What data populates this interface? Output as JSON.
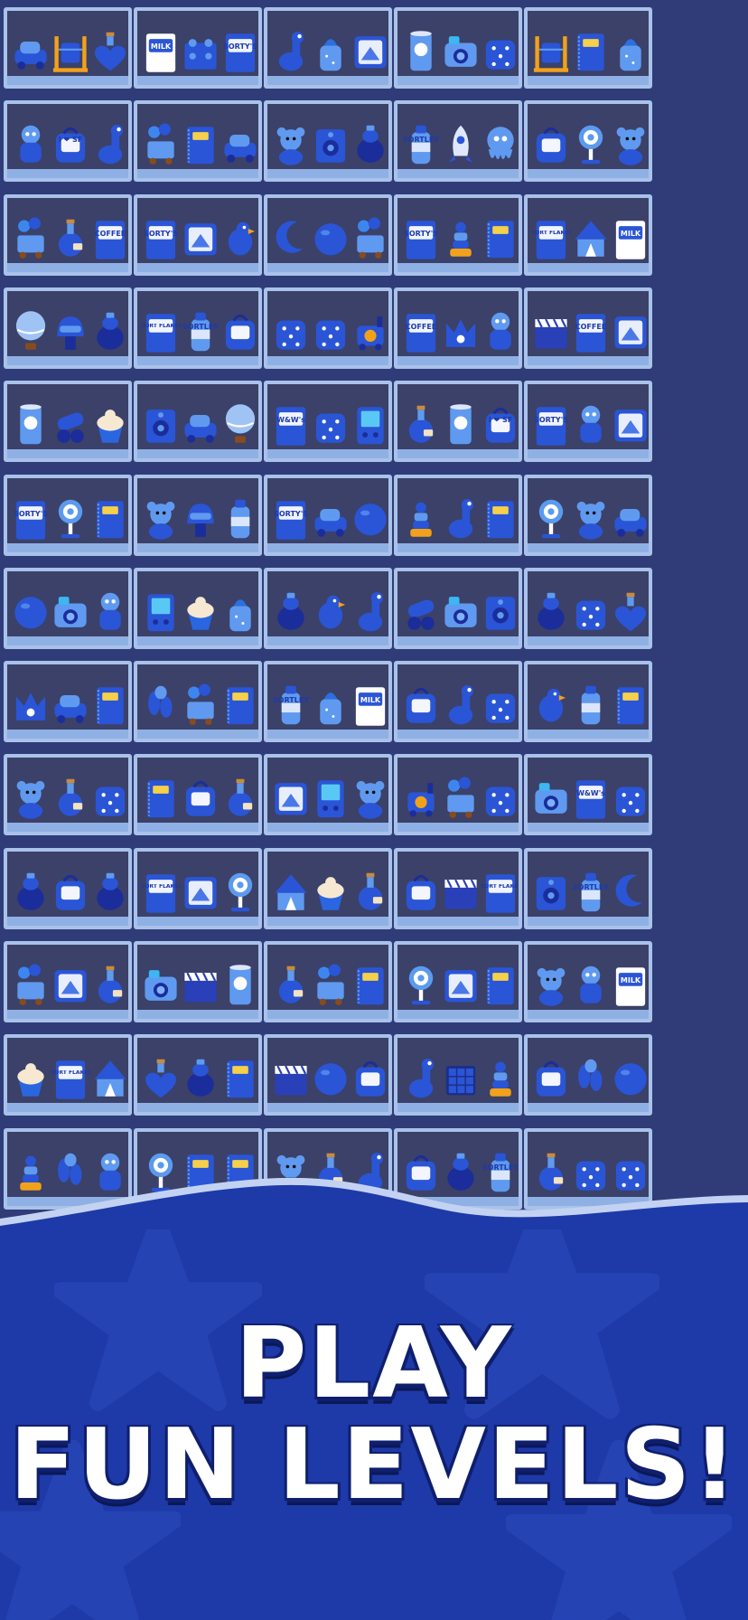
{
  "headline": {
    "line1": "PLAY",
    "line2": "FUN LEVELS!"
  },
  "shelf_items": [
    [
      "car",
      "abacus",
      "heart-bottle",
      "milk-carton",
      "lego-brick",
      "sortys-cup",
      "dinosaur",
      "baby-bottle",
      "opera-frame",
      "chips-tube",
      "camera",
      "dice-box",
      "abacus",
      "notebook",
      "baby-bottle"
    ],
    [
      "boy-figure",
      "i-love-sf-bag",
      "dinosaur",
      "ice-cream-cart",
      "spiral-notebook",
      "car",
      "teddy-bear",
      "radio",
      "vase",
      "sortley-bottle",
      "rocket",
      "octopus",
      "suitcase",
      "lollipop",
      "teddy-bear"
    ],
    [
      "balloon-cart",
      "potion-bottle",
      "coffee-pack",
      "sortys-cup",
      "postcard",
      "parrot",
      "moon",
      "ball",
      "balloon-cart",
      "sortys-cup",
      "ring-stacker",
      "spiral-notebook",
      "sort-flakes",
      "circus-tent",
      "milk-carton"
    ],
    [
      "hot-air-balloon",
      "helmet",
      "teapot",
      "sort-flakes",
      "sortley-bottle",
      "suitcase",
      "mug",
      "jar",
      "train",
      "coffee-pack",
      "crown-bag",
      "pirate-figure",
      "clapperboard",
      "coffee-pack",
      "opera-frame"
    ],
    [
      "chips-tube",
      "cannon",
      "cupcake",
      "speaker",
      "car",
      "hot-air-balloon",
      "wow-candy",
      "mug",
      "game-console",
      "star-bottle",
      "chips-tube",
      "i-love-sf-bag",
      "sortys-cup",
      "fairy-figure",
      "postcard"
    ],
    [
      "sortys-cup",
      "lollipop",
      "notebook",
      "teddy-bear",
      "helmet",
      "water-bottle",
      "sortys-cup",
      "car",
      "ball",
      "robot-stack",
      "giraffe",
      "notebook",
      "lollipop",
      "gummy-bear",
      "car"
    ],
    [
      "ball",
      "camera",
      "robot",
      "game-console",
      "cupcake",
      "baby-bottle",
      "vase",
      "parrot",
      "dinosaur",
      "cannon",
      "camera",
      "speaker",
      "vase",
      "jar",
      "heart-bottle"
    ],
    [
      "crown-bag",
      "car",
      "spiral-notebook",
      "balloon-dog",
      "balloon-cart",
      "spiral-notebook",
      "sortley-bottle",
      "baby-bottle",
      "milk-carton",
      "crayon-box",
      "dinosaur",
      "jar",
      "parrot",
      "water-bottle",
      "book"
    ],
    [
      "gummy-bear",
      "star-bottle",
      "dice",
      "notebook",
      "crayon-box",
      "potion-bottle",
      "opera-frame",
      "game-console",
      "teddy-bear",
      "train",
      "balloon-cart",
      "mug",
      "camera",
      "wow-candy",
      "mug"
    ],
    [
      "vase",
      "crayon-box",
      "vase",
      "sort-flakes",
      "postcard",
      "lollipop",
      "circus-tent",
      "cupcake",
      "star-bottle",
      "crayon-box",
      "clapperboard",
      "sort-flakes",
      "radio",
      "sortley-bottle",
      "moon"
    ],
    [
      "ice-cream-cart",
      "opera-frame",
      "potion-bottle",
      "camera",
      "clapperboard",
      "chips-tube",
      "potion-bottle",
      "ice-cream-cart",
      "book",
      "lollipop",
      "eiffel-mirror",
      "spiral-notebook",
      "teddy-bear",
      "robot",
      "milk-carton"
    ],
    [
      "cupcake",
      "sort-flakes",
      "circus-tent",
      "heart-bottle",
      "moka-pot",
      "book",
      "clapperboard",
      "globe",
      "crayon-box",
      "dinosaur",
      "rubiks-cube",
      "robot-stack",
      "backpack",
      "balloon-dog",
      "ball"
    ],
    [
      "robot-stack",
      "balloon-dog",
      "pirate-figure",
      "lollipop",
      "notebook",
      "spiral-notebook",
      "gummy-bear",
      "potion-bottle",
      "dinosaur",
      "backpack",
      "vase",
      "sortley-bottle",
      "potion-bottle",
      "dice",
      "jar"
    ]
  ],
  "item_text": {
    "milk-carton": "MILK",
    "sortys-cup": "SORTY'S",
    "coffee-pack": "COFFEE",
    "sort-flakes": "SORT FLAKES",
    "sortley-bottle": "SORTLEY",
    "wow-candy": "W&W's",
    "i-love-sf-bag": "I ❤ SF"
  },
  "colors": {
    "background": "#22306a",
    "shelf_frame": "#a9c2ea",
    "shelf_back": "#3b4168",
    "item_main": "#2a55d6",
    "item_light": "#5f9af0",
    "item_dark": "#1a2d9a",
    "banner": "#1e3aa8",
    "headline_text": "#ffffff",
    "headline_shadow": "#0f1f6e"
  }
}
